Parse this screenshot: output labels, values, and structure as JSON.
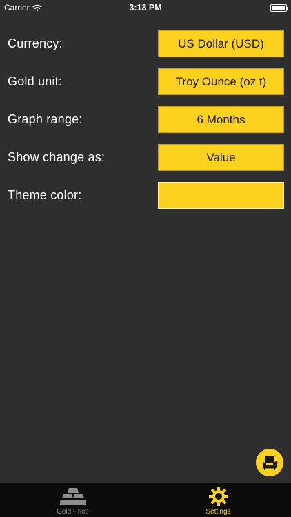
{
  "status_bar": {
    "carrier": "Carrier",
    "time": "3:13 PM"
  },
  "settings": [
    {
      "label": "Currency:",
      "value": "US Dollar (USD)"
    },
    {
      "label": "Gold unit:",
      "value": "Troy Ounce (oz t)"
    },
    {
      "label": "Graph range:",
      "value": "6 Months"
    },
    {
      "label": "Show change as:",
      "value": "Value"
    },
    {
      "label": "Theme color:",
      "value": ""
    }
  ],
  "theme_color": "#fdd21f",
  "fab": {
    "icon": "armchair-icon"
  },
  "tabs": [
    {
      "label": "Gold Price",
      "icon": "gold-bars-icon",
      "active": false
    },
    {
      "label": "Settings",
      "icon": "gear-icon",
      "active": true
    }
  ],
  "colors": {
    "background": "#2e2e2e",
    "accent": "#fdd21f",
    "tab_bar": "#0c0c0c",
    "inactive_tab": "#8e8e8e"
  }
}
